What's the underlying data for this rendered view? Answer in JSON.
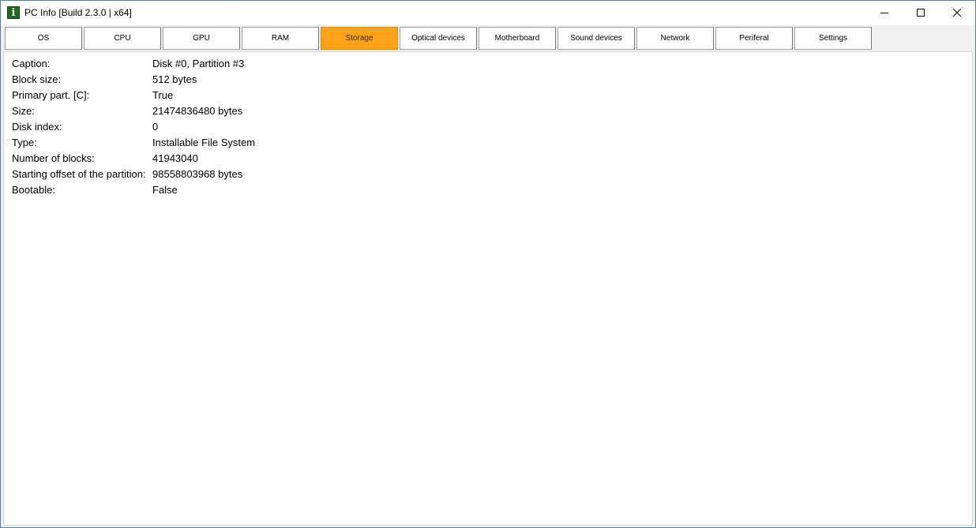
{
  "window": {
    "title": "PC Info [Build 2.3.0 | x64]",
    "icon": "info-icon",
    "icon_glyph": "i",
    "icon_color": "#1e6b1e"
  },
  "window_controls": {
    "minimize": "minimize-icon",
    "maximize": "maximize-icon",
    "close": "close-icon"
  },
  "tabs": [
    {
      "label": "OS"
    },
    {
      "label": "CPU"
    },
    {
      "label": "GPU"
    },
    {
      "label": "RAM"
    },
    {
      "label": "Storage",
      "active": true
    },
    {
      "label": "Optical devices"
    },
    {
      "label": "Motherboard"
    },
    {
      "label": "Sound devices"
    },
    {
      "label": "Network"
    },
    {
      "label": "Periferal"
    },
    {
      "label": "Settings"
    }
  ],
  "active_tab_color": "#ffa31a",
  "details": [
    {
      "label": "Caption:",
      "value": "Disk #0, Partition #3"
    },
    {
      "label": "Block size:",
      "value": "512 bytes"
    },
    {
      "label": "Primary part. [C]:",
      "value": "True"
    },
    {
      "label": "Size:",
      "value": "21474836480 bytes"
    },
    {
      "label": "Disk index:",
      "value": "0"
    },
    {
      "label": "Type:",
      "value": "Installable File System"
    },
    {
      "label": "Number of blocks:",
      "value": "41943040"
    },
    {
      "label": "Starting offset of the partition:",
      "value": "98558803968 bytes"
    },
    {
      "label": "Bootable:",
      "value": "False"
    }
  ]
}
